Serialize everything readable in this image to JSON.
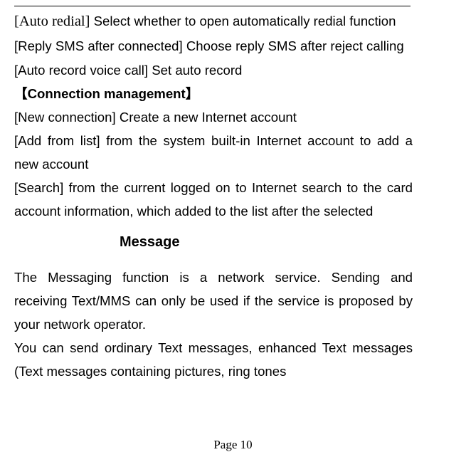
{
  "items": {
    "autoRedial": {
      "label": "[Auto redial]",
      "desc": "Select whether to open automatically redial function"
    },
    "replySms": {
      "label": "[Reply SMS after connected]",
      "desc": "Choose reply SMS after reject calling"
    },
    "autoRecord": {
      "label": "[Auto record voice call]",
      "desc": "Set auto record"
    }
  },
  "connectionHeading": "【Connection management】",
  "connItems": {
    "newConn": {
      "label": "[New connection]",
      "desc": "Create a new Internet account"
    },
    "addFromList": {
      "label": "[Add from list]",
      "desc": "from the system built-in Internet account to add a new account"
    },
    "search": {
      "label": "[Search]",
      "desc": "from the current logged on to Internet search to the card account information, which added to the list after the selected"
    }
  },
  "messageHeading": "Message",
  "messageBody": {
    "p1": "The Messaging function is a network service. Sending and receiving Text/MMS can only be used if the service is proposed by your network operator.",
    "p2": "You can send ordinary Text messages, enhanced Text messages (Text messages containing pictures, ring tones"
  },
  "pageNumber": "Page 10"
}
